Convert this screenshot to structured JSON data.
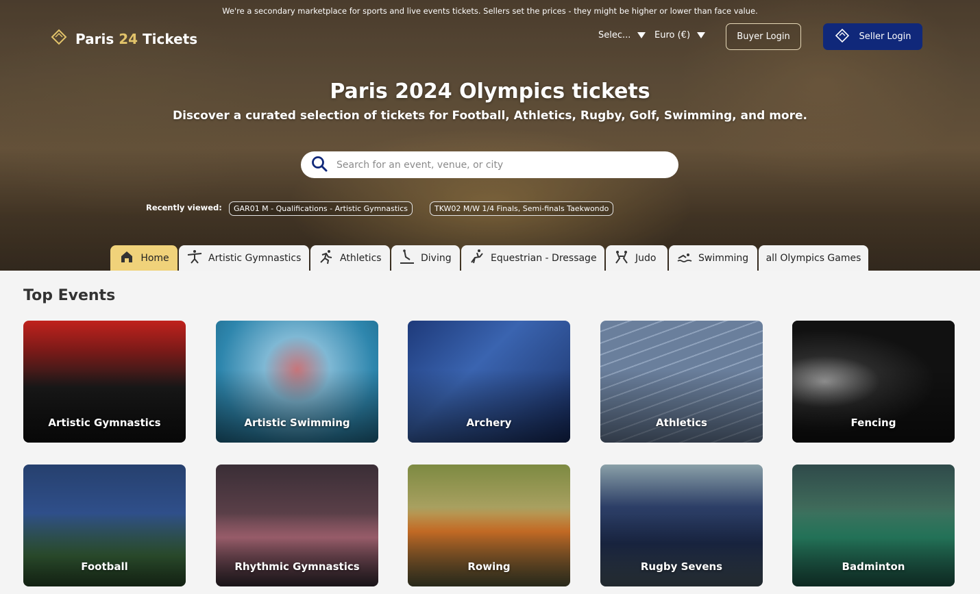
{
  "notice": "We're a secondary marketplace for sports and live events tickets. Sellers set the prices - they might be higher or lower than face value.",
  "logo": {
    "text_main": "Paris ",
    "text_accent": "24",
    "text_end": " Tickets"
  },
  "header": {
    "language": "Selec...",
    "currency": "Euro (€)",
    "buyer_login": "Buyer Login",
    "seller_login": "Seller Login"
  },
  "hero": {
    "title": "Paris 2024 Olympics tickets",
    "subtitle": "Discover a curated selection of tickets for Football, Athletics, Rugby, Golf, Swimming, and more."
  },
  "search": {
    "placeholder": "Search for an event, venue, or city"
  },
  "recently_viewed": {
    "label": "Recently viewed:",
    "items": [
      "GAR01 M - Qualifications - Artistic Gymnastics",
      "TKW02 M/W 1/4 Finals, Semi-finals Taekwondo"
    ]
  },
  "tabs": [
    {
      "label": "Home",
      "icon": "home-icon"
    },
    {
      "label": "Artistic Gymnastics",
      "icon": "gymnast-icon"
    },
    {
      "label": "Athletics",
      "icon": "runner-icon"
    },
    {
      "label": "Diving",
      "icon": "diver-icon"
    },
    {
      "label": "Equestrian - Dressage",
      "icon": "horse-rider-icon"
    },
    {
      "label": "Judo",
      "icon": "judo-icon"
    },
    {
      "label": "Swimming",
      "icon": "swimmer-icon"
    },
    {
      "label": "all Olympics Games",
      "icon": ""
    }
  ],
  "top_events": {
    "title": "Top Events",
    "cards": [
      {
        "label": "Artistic Gymnastics",
        "color": "#1a1a1a"
      },
      {
        "label": "Artistic Swimming",
        "color": "#3a8fb5"
      },
      {
        "label": "Archery",
        "color": "#2c4a8a"
      },
      {
        "label": "Athletics",
        "color": "#5a6f8c"
      },
      {
        "label": "Fencing",
        "color": "#151515"
      },
      {
        "label": "Football",
        "color": "#2b3f6e"
      },
      {
        "label": "Rhythmic Gymnastics",
        "color": "#4a3a40"
      },
      {
        "label": "Rowing",
        "color": "#6e7a3a"
      },
      {
        "label": "Rugby Sevens",
        "color": "#3d5060"
      },
      {
        "label": "Badminton",
        "color": "#2a5a4a"
      }
    ]
  },
  "colors": {
    "accent": "#f0d27a",
    "brand_blue": "#10287a",
    "logo_accent": "#e2c36a"
  }
}
